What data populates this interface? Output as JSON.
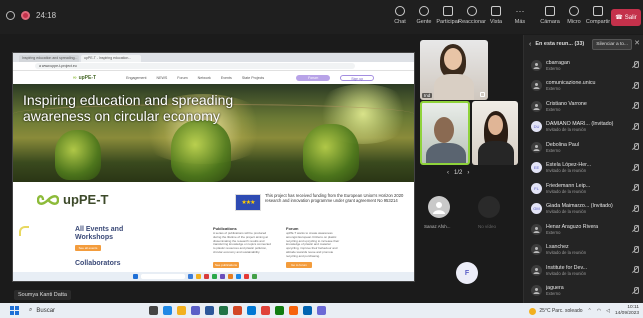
{
  "meeting": {
    "elapsed": "24:18",
    "leave_label": "Salir",
    "participant_count": "33"
  },
  "toolbar": [
    {
      "label": "Chat",
      "icon": "chat-icon"
    },
    {
      "label": "Gente",
      "icon": "people-icon"
    },
    {
      "label": "Participar",
      "icon": "raise-hand-icon"
    },
    {
      "label": "Reaccionar",
      "icon": "smile-icon"
    },
    {
      "label": "Vista",
      "icon": "view-icon"
    },
    {
      "label": "Más",
      "icon": "more-icon"
    }
  ],
  "devices": [
    {
      "label": "Cámara",
      "icon": "camera-off-icon"
    },
    {
      "label": "Micro",
      "icon": "mic-off-icon"
    },
    {
      "label": "Compartir",
      "icon": "share-icon"
    }
  ],
  "shared": {
    "browser_tabs": [
      "Inspiring education and spreading...",
      "upPE-T - Inspiring education..."
    ],
    "url": "a  www.uppe-t-project.eu",
    "nav_items": [
      "Engagement",
      "NEWS",
      "Forum",
      "Network",
      "Events",
      "State Projects"
    ],
    "nav_buttons": [
      "Forum",
      "Sign up"
    ],
    "hero_title": "Inspiring education and spreading awareness on circular economy",
    "brand_name": "upPE-T",
    "eu_text": "This project has received funding from the European Union's Horizon 2020 research and innovation programme under grant agreement No 953214",
    "events_title": "All Events and Workshops",
    "events_button": "See all events",
    "collaborators_title": "Collaborators",
    "publications_title": "Publications",
    "publications_body": "A series of publications will be produced during the lifetime of the project aiming at disseminating the research results and transferring knowledge on topics connected to plastic resources and plastic pollution, circular economy and sustainability.",
    "publications_button": "See publications",
    "forum_title": "Forum",
    "forum_body": "upPE-T wants to create awareness amongst European Citizens on plastic recycling and upcycling to increase their knowledge of plastic and material upcycling, improve their behaviour and attitude towards reuse and promote recycling and purchasing.",
    "forum_button": "Go to forum"
  },
  "presenter_name": "Soumya Kanti Datta",
  "tiles": [
    {
      "name": "Ind",
      "id": "tile-1"
    },
    {
      "name": "",
      "id": "tile-2"
    },
    {
      "name": "",
      "id": "tile-3"
    }
  ],
  "pager": "1/2",
  "avatar_tiles": [
    {
      "name": "Sanaz Afsh..."
    },
    {
      "name": "No vídeo"
    }
  ],
  "f_avatar": "F",
  "pane": {
    "title": "En esta reun... (33)",
    "mute_all": "Silenciar a to...",
    "participants": [
      {
        "initials": "",
        "name": "cbarragan",
        "role": "Externo"
      },
      {
        "initials": "",
        "name": "comunicazione.unicu",
        "role": "Externo"
      },
      {
        "initials": "",
        "name": "Cristiano Varrone",
        "role": "Externo"
      },
      {
        "initials": "DU",
        "name": "DAMIANO MARI... (Invitado)",
        "role": "Invitado de la reunión"
      },
      {
        "initials": "",
        "name": "Debolina Paul",
        "role": "Externo"
      },
      {
        "initials": "EE",
        "name": "Estela López-Her...",
        "role": "Invitado de la reunión"
      },
      {
        "initials": "FL",
        "name": "Friedemann Leip...",
        "role": "Invitado de la reunión"
      },
      {
        "initials": "GM",
        "name": "Giada Maimarzo... (Invitado)",
        "role": "Invitado de la reunión"
      },
      {
        "initials": "",
        "name": "Henar Araguzo Rivera",
        "role": "Externo"
      },
      {
        "initials": "",
        "name": "Lsanchez",
        "role": "Invitado de la reunión"
      },
      {
        "initials": "",
        "name": "Institute for Dev...",
        "role": "Invitado de la reunión"
      },
      {
        "initials": "",
        "name": "jaguera",
        "role": "Externo"
      }
    ]
  },
  "taskbar": {
    "search_placeholder": "Buscar",
    "weather": "25°C  Parc. soleado",
    "time": "10:11",
    "date": "14/09/2023"
  },
  "colors": {
    "leave": "#c4314b",
    "accent": "#5b5fc7",
    "active_speaker": "#8fd33b"
  }
}
